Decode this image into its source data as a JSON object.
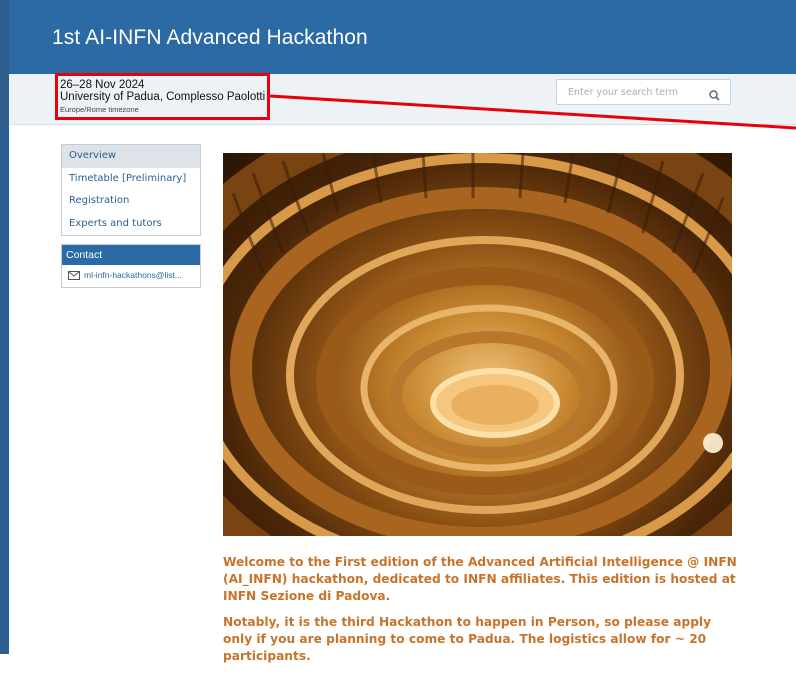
{
  "header": {
    "title": "1st AI-INFN Advanced Hackathon"
  },
  "event_info": {
    "dates": "26–28 Nov 2024",
    "venue": "University of Padua, Complesso Paolotti",
    "timezone": "Europe/Rome timezone"
  },
  "search": {
    "placeholder": "Enter your search term",
    "icon": "search-icon"
  },
  "menu": {
    "items": [
      {
        "label": "Overview",
        "active": true
      },
      {
        "label": "Timetable [Preliminary]",
        "active": false
      },
      {
        "label": "Registration",
        "active": false
      },
      {
        "label": "Experts and tutors",
        "active": false
      }
    ]
  },
  "contact": {
    "heading": "Contact",
    "email": "ml-infn-hackathons@list..."
  },
  "content": {
    "paragraphs": [
      "Welcome to the First edition of the Advanced Artificial Intelligence @ INFN (AI_INFN) hackathon, dedicated to INFN affiliates.  This edition is hosted at INFN Sezione di Padova.",
      "Notably, it is the third Hackathon to happen in Person, so please apply only if you are planning to come to Padua. The logistics allow for ~ 20 participants."
    ]
  },
  "colors": {
    "header": "#2b6aa4",
    "accent_text": "#c8732c",
    "annotation": "#e8000b"
  }
}
